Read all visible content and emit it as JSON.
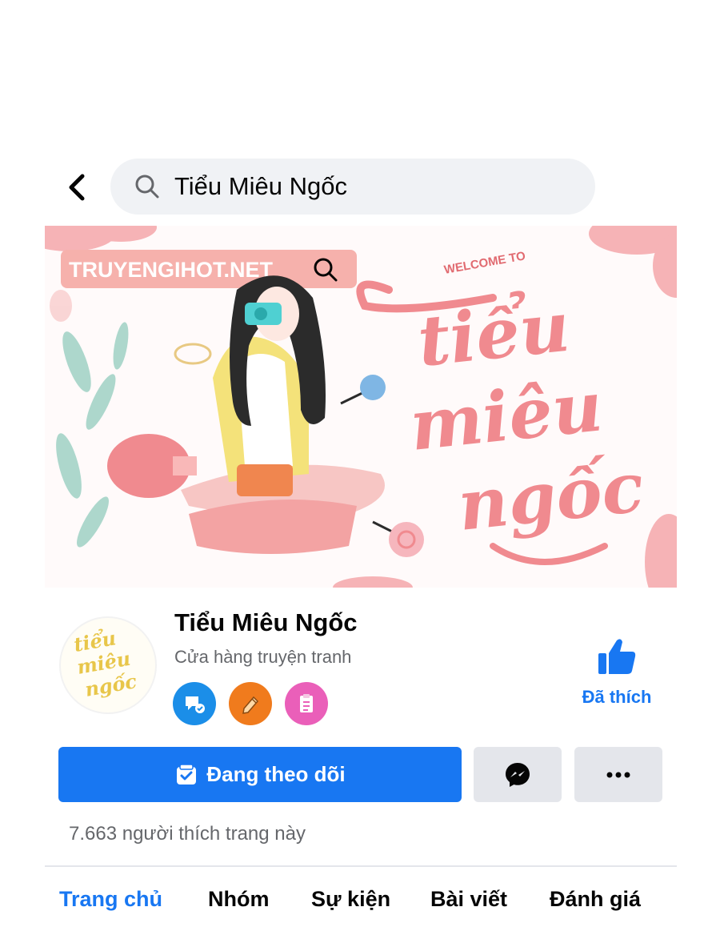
{
  "header": {
    "back_icon": "chevron-left-icon",
    "search_icon": "search-icon",
    "search_text": "Tiểu Miêu Ngốc"
  },
  "cover": {
    "site_text": "TRUYENGIHOT.NET",
    "welcome_text": "WELCOME TO",
    "script_lines": [
      "tiểu",
      "miêu",
      "ngốc"
    ]
  },
  "profile": {
    "avatar_lines": [
      "tiểu",
      "miêu",
      "ngốc"
    ],
    "name": "Tiểu Miêu Ngốc",
    "category": "Cửa hàng truyện tranh",
    "badges": [
      "responsive-messaging-icon",
      "pencil-icon",
      "clipboard-icon"
    ]
  },
  "liked": {
    "icon": "thumbs-up-icon",
    "label": "Đã thích"
  },
  "actions": {
    "follow_label": "Đang theo dõi",
    "follow_icon": "following-check-icon",
    "messenger_icon": "messenger-icon",
    "more_icon": "more-dots-icon"
  },
  "likes_count": "7.663 người thích trang này",
  "tabs": [
    {
      "label": "Trang chủ",
      "active": true
    },
    {
      "label": "Nhóm",
      "active": false
    },
    {
      "label": "Sự kiện",
      "active": false
    },
    {
      "label": "Bài viết",
      "active": false
    },
    {
      "label": "Đánh giá",
      "active": false
    }
  ],
  "colors": {
    "accent": "#1877f2",
    "secondary_bg": "#e4e6eb",
    "search_bg": "#f0f2f5",
    "cover_pink": "#f08a8f"
  }
}
